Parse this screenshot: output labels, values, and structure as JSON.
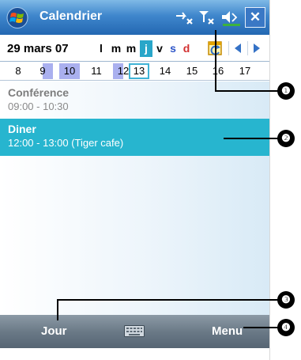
{
  "titlebar": {
    "title": "Calendrier",
    "icons": [
      "windows-start-icon",
      "connectivity-icon",
      "signal-icon",
      "volume-icon",
      "close-icon"
    ],
    "close_label": "✕"
  },
  "header": {
    "date": "29 mars 07",
    "weekdays": [
      {
        "label": "l",
        "state": "normal"
      },
      {
        "label": "m",
        "state": "normal"
      },
      {
        "label": "m",
        "state": "normal"
      },
      {
        "label": "j",
        "state": "selected"
      },
      {
        "label": "v",
        "state": "normal"
      },
      {
        "label": "s",
        "state": "saturday"
      },
      {
        "label": "d",
        "state": "sunday"
      }
    ],
    "today_icon": "goto-today-icon",
    "prev_icon": "triangle-left-icon",
    "next_icon": "triangle-right-icon"
  },
  "week_numbers": [
    "8",
    "9",
    "10",
    "11",
    "12",
    "13",
    "14",
    "15",
    "16",
    "17"
  ],
  "appointments": [
    {
      "title": "Conférence",
      "time": "09:00 - 10:30",
      "selected": false
    },
    {
      "title": "Diner",
      "time": "12:00 - 13:00 (Tiger cafe)",
      "selected": true
    }
  ],
  "menubar": {
    "left_softkey": "Jour",
    "right_softkey": "Menu",
    "keyboard_icon": "keyboard-icon"
  },
  "callouts": [
    "❶",
    "❷",
    "❸",
    "❹"
  ],
  "colors": {
    "title_bar": "#3f86cc",
    "selected_appointment": "#27b5cf",
    "week_highlight": "#aab0ef",
    "menu_bar": "#6b7a87"
  }
}
